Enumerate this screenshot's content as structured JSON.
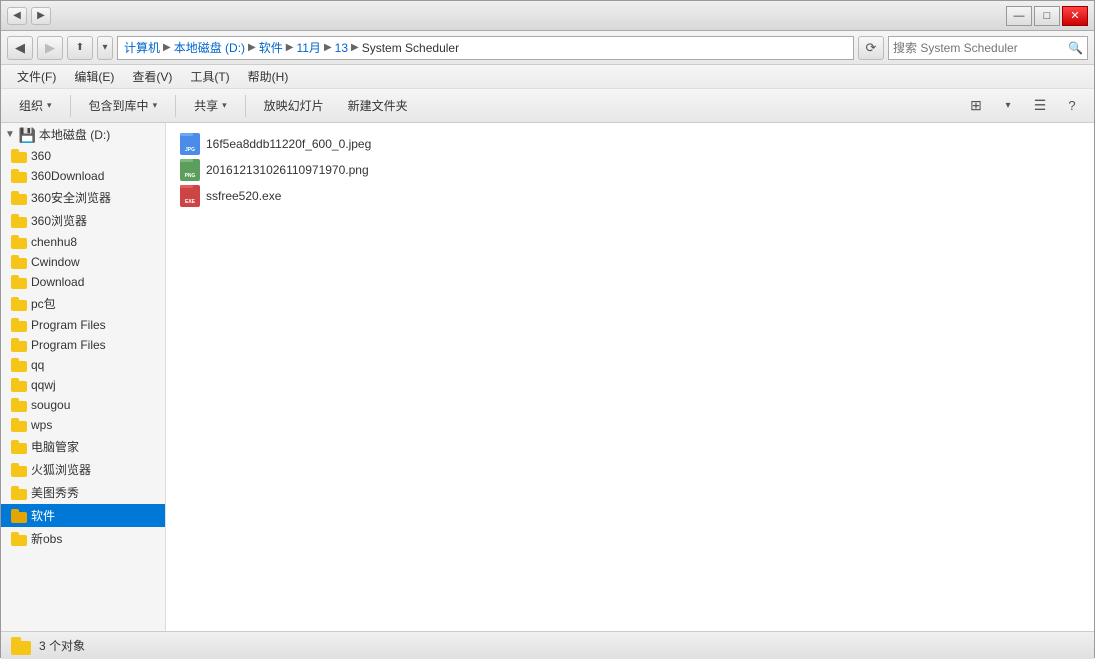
{
  "titleBar": {
    "title": "",
    "minimize": "—",
    "maximize": "□",
    "close": "✕"
  },
  "addressBar": {
    "back": "◀",
    "forward": "▶",
    "up": "▲",
    "breadcrumbs": [
      "计算机",
      "本地磁盘 (D:)",
      "软件",
      "11月",
      "13",
      "System Scheduler"
    ],
    "refresh": "⟳",
    "searchPlaceholder": "搜索 System Scheduler"
  },
  "menuBar": {
    "items": [
      "文件(F)",
      "编辑(E)",
      "查看(V)",
      "工具(T)",
      "帮助(H)"
    ]
  },
  "toolbar": {
    "organize": "组织",
    "include": "包含到库中",
    "share": "共享",
    "slideshow": "放映幻灯片",
    "newFolder": "新建文件夹"
  },
  "sidebar": {
    "root": "本地磁盘 (D:)",
    "items": [
      {
        "name": "360",
        "indent": 1
      },
      {
        "name": "360Download",
        "indent": 1
      },
      {
        "name": "360安全浏览器",
        "indent": 1
      },
      {
        "name": "360浏览器",
        "indent": 1
      },
      {
        "name": "chenhu8",
        "indent": 1
      },
      {
        "name": "Cwindow",
        "indent": 1
      },
      {
        "name": "Download",
        "indent": 1
      },
      {
        "name": "pc包",
        "indent": 1
      },
      {
        "name": "Program Files",
        "indent": 1
      },
      {
        "name": "Program Files",
        "indent": 1
      },
      {
        "name": "qq",
        "indent": 1
      },
      {
        "name": "qqwj",
        "indent": 1
      },
      {
        "name": "sougou",
        "indent": 1
      },
      {
        "name": "wps",
        "indent": 1
      },
      {
        "name": "电脑管家",
        "indent": 1
      },
      {
        "name": "火狐浏览器",
        "indent": 1
      },
      {
        "name": "美图秀秀",
        "indent": 1
      },
      {
        "name": "软件",
        "indent": 1,
        "active": true
      },
      {
        "name": "新obs",
        "indent": 1
      }
    ]
  },
  "fileList": {
    "files": [
      {
        "name": "16f5ea8ddb11220f_600_0.jpeg",
        "type": "jpeg"
      },
      {
        "name": "201612131026110971970.png",
        "type": "png"
      },
      {
        "name": "ssfree520.exe",
        "type": "exe"
      }
    ]
  },
  "statusBar": {
    "count": "3 个对象"
  }
}
